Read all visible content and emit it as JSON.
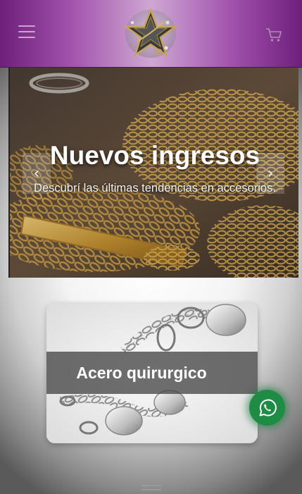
{
  "header": {
    "menu_icon": "hamburger-icon",
    "logo_icon": "star-logo-icon",
    "cart_icon": "cart-icon"
  },
  "hero": {
    "title": "Nuevos ingresos",
    "subtitle": "Descubrí las últimas tendencias en accesorios.",
    "prev_label": "‹",
    "next_label": "›"
  },
  "category_card": {
    "label": "Acero quirurgico"
  },
  "whatsapp": {
    "icon": "whatsapp-icon"
  },
  "colors": {
    "header_purple": "#9e4faa",
    "whatsapp_green": "#1f8c45"
  }
}
